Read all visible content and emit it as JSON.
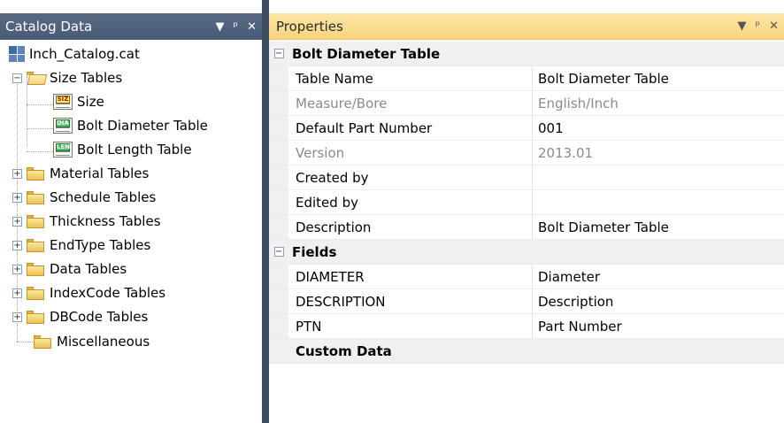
{
  "left_panel": {
    "title": "Catalog Data",
    "header_icons": [
      "dropdown-arrow-icon",
      "pin-icon",
      "close-icon"
    ],
    "root": "Inch_Catalog.cat",
    "size_tables": {
      "label": "Size Tables",
      "children": [
        {
          "label": "Size",
          "icon_tag": "SIZ"
        },
        {
          "label": "Bolt Diameter Table",
          "icon_tag": "DIA"
        },
        {
          "label": "Bolt Length Table",
          "icon_tag": "LEN"
        }
      ]
    },
    "folders": [
      "Material Tables",
      "Schedule Tables",
      "Thickness Tables",
      "EndType Tables",
      "Data Tables",
      "IndexCode Tables",
      "DBCode Tables"
    ],
    "misc": "Miscellaneous"
  },
  "right_panel": {
    "title": "Properties",
    "header_icons": [
      "dropdown-arrow-icon",
      "pin-icon",
      "close-icon"
    ],
    "sections": [
      {
        "title": "Bolt Diameter Table",
        "rows": [
          {
            "name": "Table Name",
            "value": "Bolt Diameter Table",
            "readonly": false
          },
          {
            "name": "Measure/Bore",
            "value": "English/Inch",
            "readonly": true
          },
          {
            "name": "Default Part Number",
            "value": "001",
            "readonly": false
          },
          {
            "name": "Version",
            "value": "2013.01",
            "readonly": true
          },
          {
            "name": "Created by",
            "value": "",
            "readonly": false
          },
          {
            "name": "Edited by",
            "value": "",
            "readonly": false
          },
          {
            "name": "Description",
            "value": "Bolt Diameter Table",
            "readonly": false
          }
        ]
      },
      {
        "title": "Fields",
        "rows": [
          {
            "name": "DIAMETER",
            "value": "Diameter",
            "readonly": false
          },
          {
            "name": "DESCRIPTION",
            "value": "Description",
            "readonly": false
          },
          {
            "name": "PTN",
            "value": "Part Number",
            "readonly": false
          }
        ]
      }
    ],
    "custom_data_label": "Custom Data"
  },
  "colors": {
    "left_header": "#4f6080",
    "right_header": "#fbdc8e",
    "splitter": "#3f4d63",
    "category_bg": "#f0f0f0"
  }
}
